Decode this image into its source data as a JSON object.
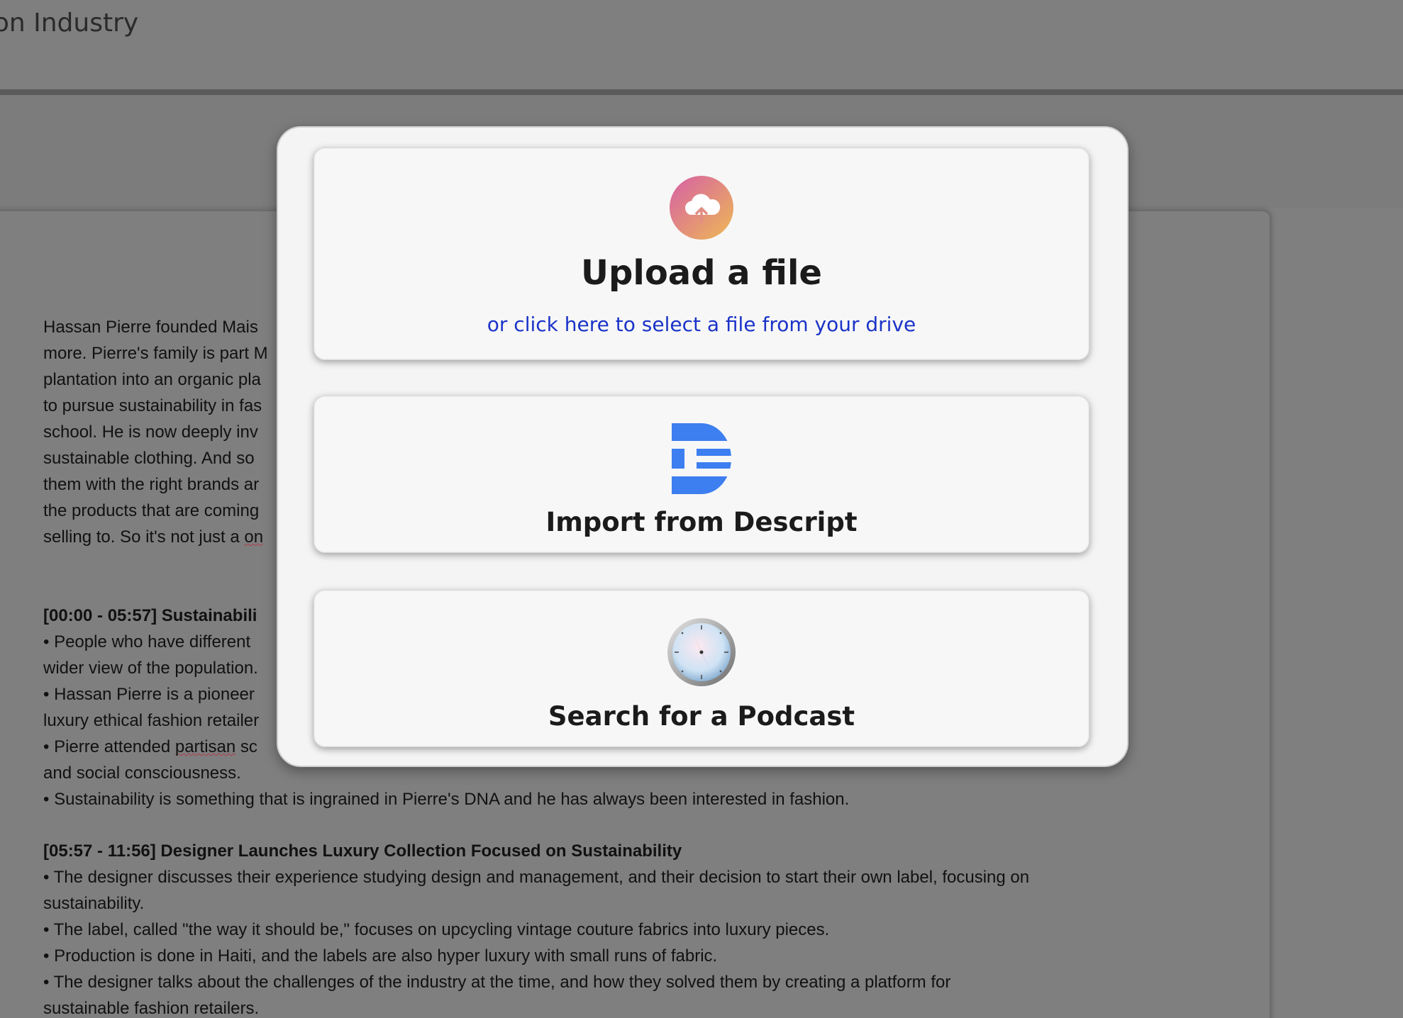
{
  "header": {
    "title_fragment": "hion Industry"
  },
  "document": {
    "intro_lines": [
      "Hassan Pierre founded Mais",
      "more. Pierre's family is part M",
      "plantation into an organic pla",
      "to pursue sustainability in fas",
      "school. He is now deeply inv",
      "sustainable clothing. And so",
      "them with the right brands ar",
      "the products that are coming",
      "selling to. So it's not just a "
    ],
    "intro_spell_word": "on",
    "sections": [
      {
        "heading": "[00:00 - 05:57] Sustainabili",
        "bullets": [
          "• People who have different",
          "wider view of the population.",
          "• Hassan Pierre is a pioneer",
          "luxury ethical fashion retailer"
        ],
        "extra_bullet_prefix": "• Pierre attended ",
        "extra_bullet_spell": "partisan",
        "extra_bullet_suffix": " sc",
        "trailing": [
          "and social consciousness.",
          "• Sustainability is something that is ingrained in Pierre's DNA and he has always been interested in fashion."
        ]
      },
      {
        "heading": "[05:57 - 11:56] Designer Launches Luxury Collection Focused on Sustainability",
        "bullets": [
          "• The designer discusses their experience studying design and management, and their decision to start their own label, focusing on",
          "sustainability.",
          "• The label, called \"the way it should be,\" focuses on upcycling vintage couture fabrics into luxury pieces.",
          "• Production is done in Haiti, and the labels are also hyper luxury with small runs of fabric.",
          "• The designer talks about the challenges of the industry at the time, and how they solved them by creating a platform for",
          "sustainable fashion retailers."
        ]
      }
    ]
  },
  "modal": {
    "upload": {
      "title": "Upload a file",
      "link": "or click here to select a file from your drive",
      "icon": "cloud-upload-icon",
      "icon_gradient": [
        "#d96a9e",
        "#e8b35a"
      ]
    },
    "descript": {
      "title": "Import from Descript",
      "icon": "descript-logo-icon",
      "icon_color": "#3d7ef0"
    },
    "podcast": {
      "title": "Search for a Podcast",
      "icon": "compass-icon"
    }
  }
}
